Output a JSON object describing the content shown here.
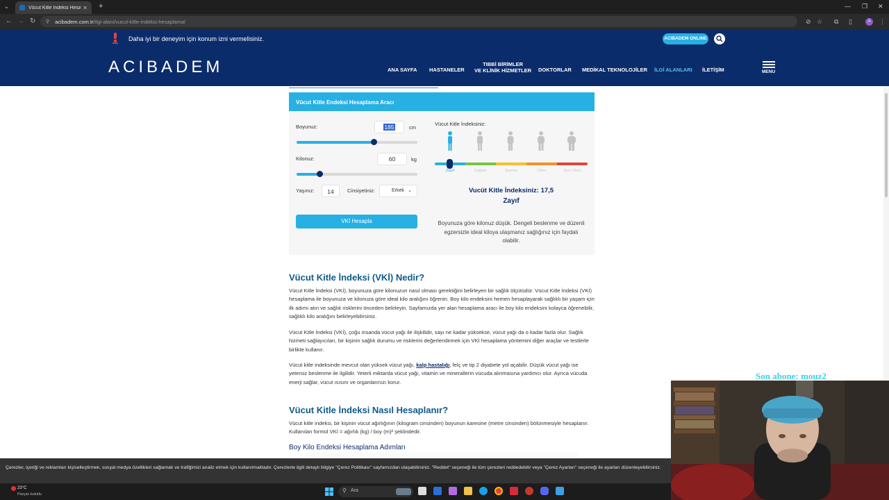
{
  "browser": {
    "tab_title": "Vücut Kitle İndeksi Hesaplama",
    "tab_close": "✕",
    "new_tab": "+",
    "url_domain": "acibadem.com.tr",
    "url_path": "/ilgi-alani/vucut-kitle-indeksi-hesaplama/",
    "profile_initial": "A"
  },
  "header": {
    "location_notice": "Daha iyi bir deneyim için konum izni vermelisiniz.",
    "online_button": "ACIBADEM ONLINE",
    "logo": "ACIBADEM",
    "nav": [
      {
        "label": "ANA SAYFA"
      },
      {
        "label": "HASTANELER"
      },
      {
        "label_line1": "TIBBİ BİRİMLER",
        "label_line2": "VE KLİNİK HİZMETLER"
      },
      {
        "label": "DOKTORLAR"
      },
      {
        "label": "MEDİKAL TEKNOLOJİLER"
      },
      {
        "label": "İLGİ ALANLARI"
      },
      {
        "label": "İLETİŞİM"
      }
    ],
    "menu_label": "MENU"
  },
  "calculator": {
    "title": "Vücut Kitle Endeksi Hesaplama Aracı",
    "height_label": "Boyunuz:",
    "height_value": "185",
    "height_unit": "cm",
    "height_slider_fraction": 0.64,
    "weight_label": "Kilonuz:",
    "weight_value": "60",
    "weight_unit": "kg",
    "weight_slider_fraction": 0.19,
    "age_label": "Yaşınız:",
    "age_value": "14",
    "gender_label": "Cinsiyetiniz:",
    "gender_value": "Erkek",
    "button": "VKİ Hesapla",
    "index_label": "Vücut Kitle İndeksiniz:",
    "categories": [
      "Zayıf",
      "Sağlıklı",
      "Şişman",
      "Obez",
      "Aşırı Obez"
    ],
    "category_colors": [
      "#27b0e4",
      "#7cc243",
      "#f2c230",
      "#f0922b",
      "#e2453c"
    ],
    "result_text": "Vucüt Kitle İndeksiniz: 17,5",
    "result_category": "Zayıf",
    "advice": "Boyunuza göre kilonuz düşük. Dengeli beslenme ve düzenli egzersizle ideal kiloya ulaşmanız sağlığınız için faydalı olabilir."
  },
  "article": {
    "h1": "Vücut Kitle İndeksi (VKİ) Nedir?",
    "p1": "Vücut Kitle İndeksi (VKİ), boyunuza göre kilonuzun nasıl olması gerektiğini belirleyen bir sağlık ölçütüdür. Vücut Kitle İndeksi (VKİ) hesaplama ile boyunuza ve kilonuza göre ideal kilo aralığını öğrenin. Boy kilo endeksini hemen hesaplayarak sağlıklı bir yaşam için ilk adımı atın ve sağlık risklerini önceden belirleyin. Sayfamızda yer alan hesaplama aracı ile boy kilo endeksini kolayca öğrenebilir, sağlıklı kilo aralığını belirleyebilirsiniz.",
    "p2": "Vücut Kitle İndeksi (VKİ), çoğu insanda vücut yağı ile ilişkilidir, sayı ne kadar yüksekse, vücut yağı da o kadar fazla olur. Sağlık hizmeti sağlayıcıları, bir kişinin sağlık durumu ve risklerini değerlendirmek için VKİ hesaplama yöntemini diğer araçlar ve testlerle birlikte kullanır.",
    "p3_before": "Vücut kitle indeksinde mevcut olan yüksek vücut yağı, ",
    "p3_link": "kalp hastalığı",
    "p3_after": ", felç ve tip 2 diyabete yol açabilir. Düşük vücut yağı ise yetersiz beslenme ile ilgilidir. Yeterli miktarda vücut yağı, vitamin ve minerallerin vücuda alınmasına yardımcı olur. Ayrıca vücuda enerji sağlar, vücut ısısını ve organlarınızı korur.",
    "h2": "Vücut Kitle İndeksi Nasıl Hesaplanır?",
    "p4": "Vücut kitle indeksi, bir kişinin vücut ağırlığının (kilogram cinsinden) boyunun karesine (metre cinsinden) bölünmesiyle hesaplanır. Kullanılan formül VKİ = ağırlık (kg) / boy (m)² şeklindedir.",
    "h3": "Boy Kilo Endeksi Hesaplama Adımları"
  },
  "cookie": {
    "text": "Çerezler, içeriği ve reklamları kişiselleştirmek, sosyal medya özellikleri sağlamak ve trafiğimizi analiz etmek için kullanılmaktadır. Çerezlerle ilgili detaylı bilgiye \"Çerez Politikası\" sayfamızdan ulaşabilirsiniz. \"Reddet\" seçeneği ile tüm çerezleri reddedebilir veya \"Çerez Ayarları\" seçeneği ile ayarları düzenleyebilirsiniz."
  },
  "taskbar": {
    "weather_temp": "23°C",
    "weather_desc": "Parçalı bulutlu",
    "weather_badge": "1",
    "search_placeholder": "Ara"
  },
  "stream_overlay": {
    "text": "Son abone: mouz2"
  }
}
